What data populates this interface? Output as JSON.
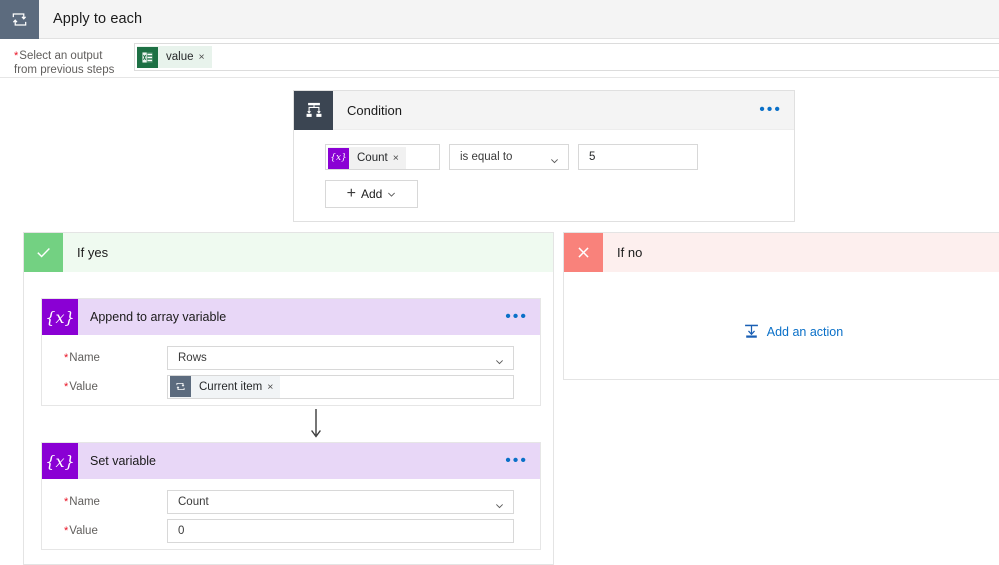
{
  "header": {
    "icon": "loop-icon",
    "title": "Apply to each"
  },
  "output_row": {
    "label_line1": "Select an output",
    "label_line2": "from previous steps",
    "required": true,
    "token": {
      "icon": "excel-icon",
      "label": "value",
      "remove": "×"
    }
  },
  "condition": {
    "icon": "condition-branch-icon",
    "title": "Condition",
    "overflow": "•••",
    "operand": {
      "icon": "variable-icon",
      "label": "Count",
      "remove": "×"
    },
    "operator": "is equal to",
    "value": "5",
    "add_button": {
      "plus": "+",
      "label": "Add",
      "chevron": "chevron-down-icon"
    }
  },
  "branches": {
    "yes": {
      "icon": "checkmark-icon",
      "title": "If yes",
      "actions": [
        {
          "icon": "variable-icon",
          "glyph": "{x}",
          "title": "Append to array variable",
          "overflow": "•••",
          "fields": [
            {
              "label": "Name",
              "required": true,
              "value": "Rows",
              "type": "select"
            },
            {
              "label": "Value",
              "required": true,
              "value": "",
              "type": "token",
              "token": {
                "icon": "current-item-icon",
                "label": "Current item",
                "remove": "×"
              }
            }
          ]
        },
        {
          "icon": "variable-icon",
          "glyph": "{x}",
          "title": "Set variable",
          "overflow": "•••",
          "fields": [
            {
              "label": "Name",
              "required": true,
              "value": "Count",
              "type": "select"
            },
            {
              "label": "Value",
              "required": true,
              "value": "0",
              "type": "text"
            }
          ]
        }
      ]
    },
    "no": {
      "icon": "close-x-icon",
      "title": "If no",
      "add_action": {
        "icon": "add-action-icon",
        "label": "Add an action"
      }
    }
  },
  "colors": {
    "header_icon_bg": "#5c6b7e",
    "condition_icon_bg": "#3b4552",
    "variable_purple": "#8a00d4",
    "variable_header": "#e8d7f7",
    "yes_green": "#73d182",
    "yes_header": "#effaf0",
    "no_red": "#f9827b",
    "no_header": "#fdefee",
    "excel_green": "#1d7044",
    "link_blue": "#0a70c8",
    "required_red": "#e81123"
  }
}
